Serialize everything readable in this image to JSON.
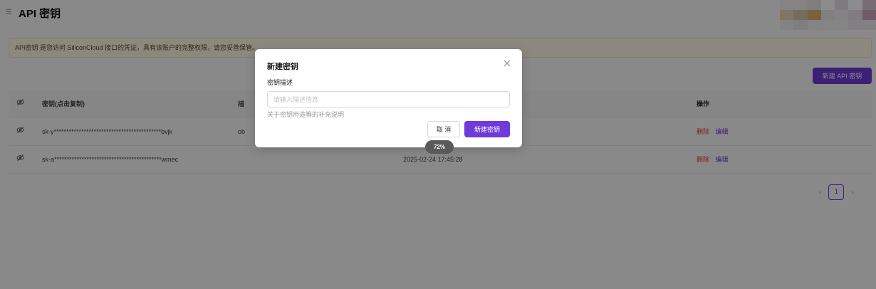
{
  "header": {
    "title": "API 密钥"
  },
  "notice": {
    "text": "API密钥 是您访问 SiliconCloud 接口的凭证，具有该账户的完整权限，请您妥善保管。"
  },
  "toolbar": {
    "new_key_label": "新建 API 密钥"
  },
  "table": {
    "columns": {
      "key": "密钥(点击复制)",
      "description": "描",
      "ops": "操作"
    },
    "rows": [
      {
        "key": "sk-y*******************************************bvjk",
        "description": "ob",
        "created": "",
        "delete": "删除",
        "edit": "编辑"
      },
      {
        "key": "sk-a*******************************************wmec",
        "description": "",
        "created": "2025-02-24 17:45:28",
        "delete": "删除",
        "edit": "编辑"
      }
    ]
  },
  "pagination": {
    "prev": "‹",
    "current": "1",
    "next": "›"
  },
  "modal": {
    "title": "新建密钥",
    "field_label": "密钥描述",
    "input_value": "",
    "input_placeholder": "请输入描述信息",
    "help_text": "关于密钥用途等的补充说明",
    "cancel_label": "取 消",
    "confirm_label": "新建密钥"
  },
  "zoom": "72%",
  "colors": {
    "accent": "#6f3ad8",
    "danger": "#e53935",
    "notice_bg": "#fdf8e6"
  }
}
